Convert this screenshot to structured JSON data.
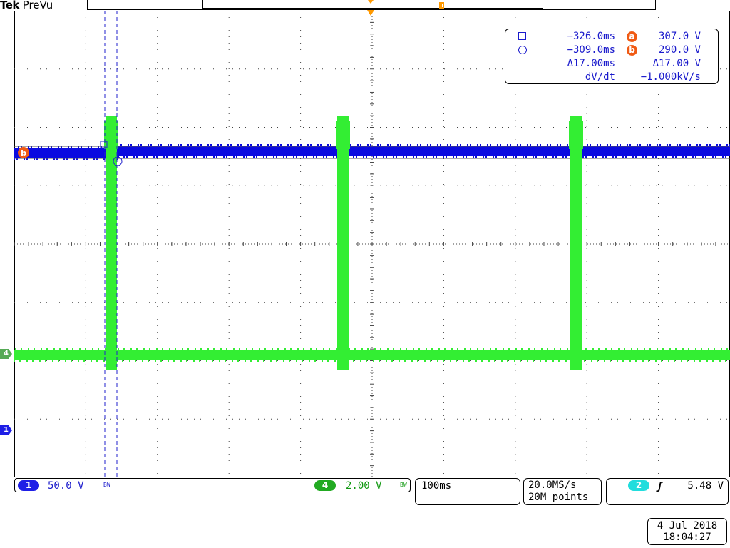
{
  "header": {
    "brand": "Tek",
    "mode": "PreVu"
  },
  "channels": [
    {
      "id": "1",
      "scale": "50.0 V",
      "bandwidth_mark": "BW",
      "color": "#1e1ee6"
    },
    {
      "id": "4",
      "scale": "2.00 V",
      "bandwidth_mark": "BW",
      "color": "#22cc22"
    }
  ],
  "cursor_readout": {
    "cursor_a_time": "−326.0ms",
    "cursor_a_label": "a",
    "cursor_a_value": "307.0 V",
    "cursor_b_time": "−309.0ms",
    "cursor_b_label": "b",
    "cursor_b_value": "290.0 V",
    "delta_time": "Δ17.00ms",
    "delta_value": "Δ17.00 V",
    "rate_label": "dV/dt",
    "rate_value": "−1.000kV/s"
  },
  "horizontal": {
    "time_per_div": "100ms",
    "sample_rate": "20.0MS/s",
    "record_length": "20M points"
  },
  "trigger": {
    "source": "2",
    "slope_icon": "rising-edge-icon",
    "level": "5.48 V"
  },
  "timestamp": {
    "date": "4 Jul  2018",
    "time": "18:04:27"
  },
  "marker_labels": {
    "ch1": "1",
    "ch4": "4",
    "cursor_b": "b"
  },
  "waveform_colors": {
    "ch1_trace": "#0a0ae0",
    "ch4_trace": "#33ee33",
    "cursor_line": "#2222cc",
    "cursor_badge": "#f05a14",
    "trigger_marker": "#ff9900"
  }
}
